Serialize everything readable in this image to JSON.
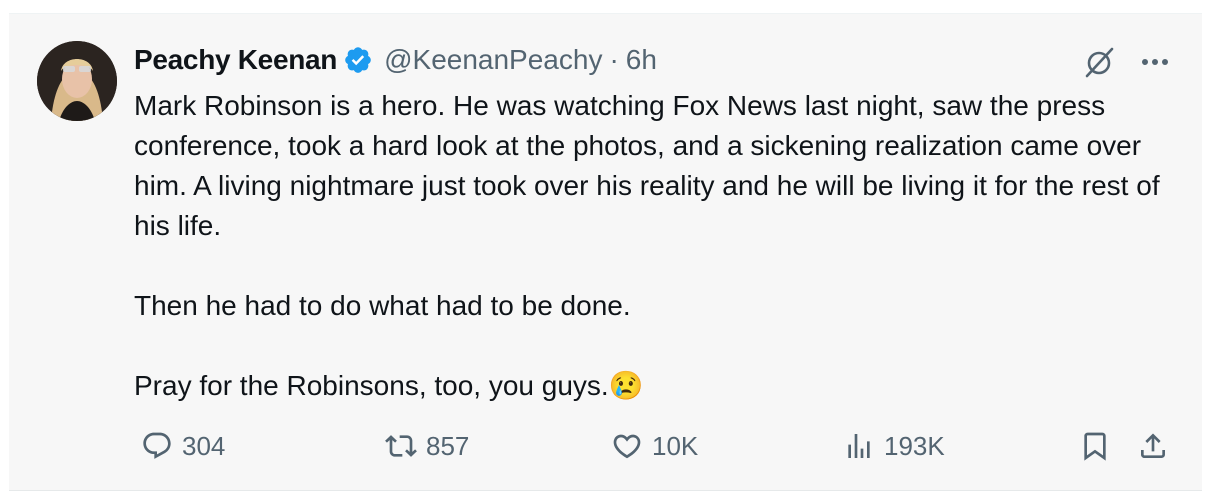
{
  "author": {
    "name": "Peachy Keenan",
    "handle": "@KeenanPeachy",
    "separator": "·",
    "time": "6h",
    "avatar_icon": "avatar-photo",
    "verified_icon": "verified-badge-icon",
    "verified_color": "#1d9bf0"
  },
  "tweet": {
    "paragraphs": [
      "Mark Robinson is a hero. He was watching Fox News last night, saw the press conference, took a hard look at the photos, and a sickening realization came over him. A living nightmare just took over his reality and he will be living it for the rest of his life.",
      "Then he had to do what had to be done.",
      "Pray for the Robinsons, too, you guys.😢"
    ]
  },
  "actions": {
    "replies": "304",
    "reposts": "857",
    "likes": "10K",
    "views": "193K"
  },
  "icons": {
    "grok": "grok-icon",
    "more": "more-icon",
    "reply": "reply-icon",
    "repost": "repost-icon",
    "like": "heart-icon",
    "views": "views-icon",
    "bookmark": "bookmark-icon",
    "share": "share-icon"
  },
  "colors": {
    "text": "#0f1419",
    "secondary": "#536471",
    "background": "#f7f7f7"
  }
}
